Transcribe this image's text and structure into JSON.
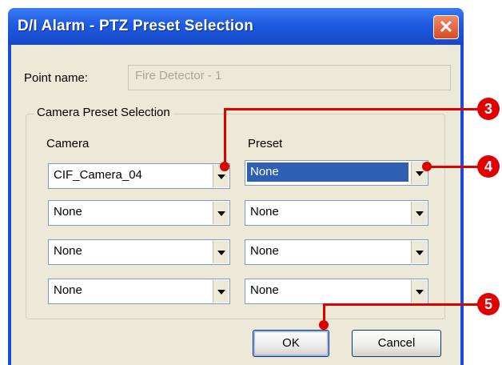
{
  "window": {
    "title": "D/I Alarm - PTZ Preset Selection",
    "close_glyph": "✕"
  },
  "point_name": {
    "label": "Point name:",
    "value": "Fire Detector - 1"
  },
  "group": {
    "title": "Camera Preset Selection",
    "camera_header": "Camera",
    "preset_header": "Preset"
  },
  "rows": [
    {
      "camera": "CIF_Camera_04",
      "preset": "None"
    },
    {
      "camera": "None",
      "preset": "None"
    },
    {
      "camera": "None",
      "preset": "None"
    },
    {
      "camera": "None",
      "preset": "None"
    }
  ],
  "buttons": {
    "ok": "OK",
    "cancel": "Cancel"
  },
  "callouts": [
    "3",
    "4",
    "5"
  ],
  "colors": {
    "callout": "#e00000",
    "titlebar": "#1f5be0",
    "selection": "#2f5fb5"
  }
}
